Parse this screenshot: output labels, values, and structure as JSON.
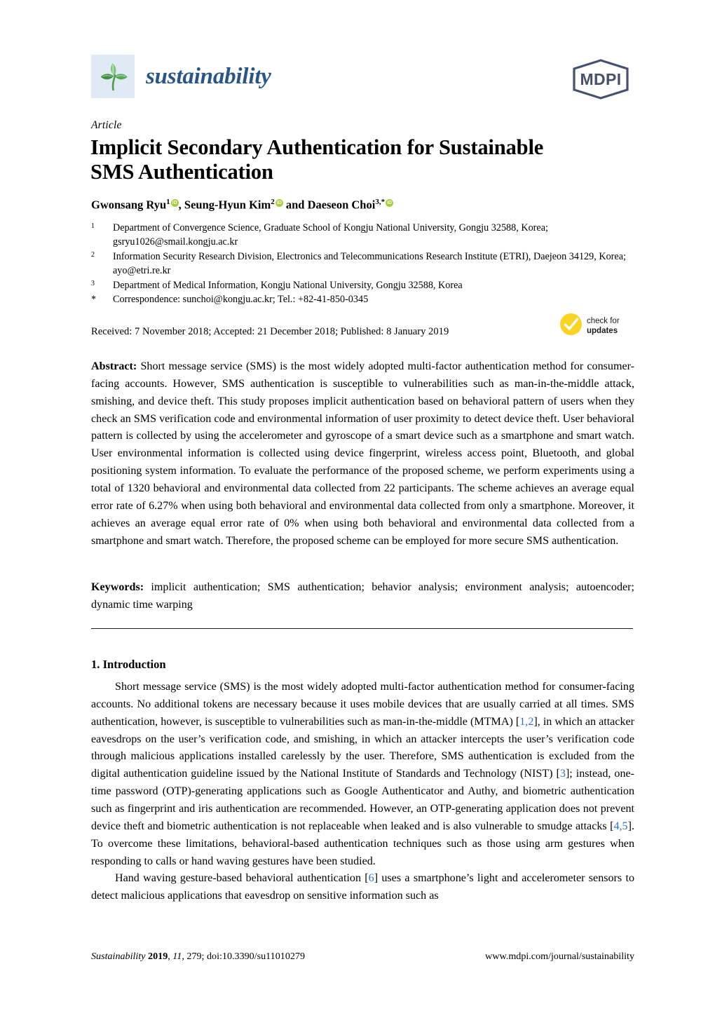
{
  "masthead": {
    "journal_name": "sustainability",
    "journal_logo_icon": "plant-leaves-icon",
    "publisher_logo_text": "MDPI",
    "publisher_logo_icon": "mdpi-hexagon-logo",
    "logo_bg_color": "#dfeaf4",
    "journal_name_color": "#2a5685",
    "publisher_color": "#46516d"
  },
  "article": {
    "type": "Article",
    "title": "Implicit Secondary Authentication for Sustainable SMS Authentication",
    "title_line1": "Implicit Secondary Authentication for Sustainable",
    "title_line2": "SMS Authentication"
  },
  "authors": {
    "author1_name": "Gwonsang Ryu",
    "author1_sup": "1",
    "author2_name": "Seung-Hyun Kim",
    "author2_sup": "2",
    "conjunction": "and",
    "author3_name": "Daeseon Choi",
    "author3_sup": "3,*",
    "separator": ", ",
    "orcid_badge_label": "iD",
    "orcid_color": "#a6ce39"
  },
  "affiliations": [
    {
      "marker": "1",
      "text": "Department of Convergence Science, Graduate School of Kongju National University, Gongju 32588, Korea; gsryu1026@smail.kongju.ac.kr"
    },
    {
      "marker": "2",
      "text": "Information Security Research Division, Electronics and Telecommunications Research Institute (ETRI), Daejeon 34129, Korea; ayo@etri.re.kr"
    },
    {
      "marker": "3",
      "text": "Department of Medical Information, Kongju National University, Gongju 32588, Korea"
    },
    {
      "marker": "*",
      "text": "Correspondence: sunchoi@kongju.ac.kr; Tel.: +82-41-850-0345"
    }
  ],
  "dates": {
    "line": "Received: 7 November 2018; Accepted: 21 December 2018; Published: 8 January 2019"
  },
  "crossmark": {
    "icon": "check-circle-icon",
    "line1": "check for",
    "line2": "updates",
    "color": "#f9d423"
  },
  "abstract": {
    "label": "Abstract:",
    "text": "Short message service (SMS) is the most widely adopted multi-factor authentication method for consumer-facing accounts. However, SMS authentication is susceptible to vulnerabilities such as man-in-the-middle attack, smishing, and device theft. This study proposes implicit authentication based on behavioral pattern of users when they check an SMS verification code and environmental information of user proximity to detect device theft.  User behavioral pattern is collected by using the accelerometer and gyroscope of a smart device such as a smartphone and smart watch. User environmental information is collected using device fingerprint, wireless access point, Bluetooth, and global positioning system information. To evaluate the performance of the proposed scheme, we perform experiments using a total of 1320 behavioral and environmental data collected from 22 participants. The scheme achieves an average equal error rate of 6.27% when using both behavioral and environmental data collected from only a smartphone. Moreover, it achieves an average equal error rate of 0% when using both behavioral and environmental data collected from a smartphone and smart watch. Therefore, the proposed scheme can be employed for more secure SMS authentication."
  },
  "keywords": {
    "label": "Keywords:",
    "text": "implicit authentication; SMS authentication; behavior analysis; environment analysis; autoencoder; dynamic time warping"
  },
  "introduction": {
    "heading": "1. Introduction",
    "para1_a": "Short message service (SMS) is the most widely adopted multi-factor authentication method for consumer-facing accounts.  No additional tokens are necessary because it uses mobile devices that are usually carried at all times. SMS authentication, however, is susceptible to vulnerabilities such as man-in-the-middle (MTMA) [",
    "cite1": "1,2",
    "para1_b": "], in which an attacker eavesdrops on the user’s verification code, and smishing, in which an attacker intercepts the user’s verification code through malicious applications installed carelessly by the user. Therefore, SMS authentication is excluded from the digital authentication guideline issued by the National Institute of Standards and Technology (NIST) [",
    "cite2": "3",
    "para1_c": "]; instead, one-time password (OTP)-generating applications such as Google Authenticator and Authy, and biometric authentication such as fingerprint and iris authentication are recommended. However, an OTP-generating application does not prevent device theft and biometric authentication is not replaceable when leaked and is also vulnerable to smudge attacks [",
    "cite3": "4,5",
    "para1_d": "]. To overcome these limitations, behavioral-based authentication techniques such as those using arm gestures when responding to calls or hand waving gestures have been studied.",
    "para2_a": "Hand waving gesture-based behavioral authentication [",
    "cite4": "6",
    "para2_b": "] uses a smartphone’s light and accelerometer sensors to detect malicious applications that eavesdrop on sensitive information such as",
    "citation_color": "#2f6fd0"
  },
  "footer": {
    "journal": "Sustainability",
    "year": "2019",
    "volume": "11",
    "article_number": "279",
    "doi": "doi:10.3390/su11010279",
    "left_full": "Sustainability 2019, 11, 279; doi:10.3390/su11010279",
    "right": "www.mdpi.com/journal/sustainability"
  }
}
